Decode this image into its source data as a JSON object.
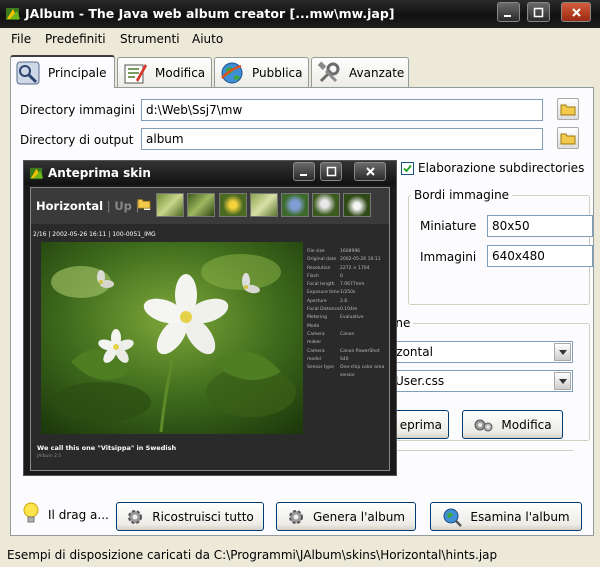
{
  "window": {
    "title": "JAlbum - The Java web album creator [...mw\\mw.jap]"
  },
  "menu": {
    "items": [
      {
        "label": "File"
      },
      {
        "label": "Predefiniti"
      },
      {
        "label": "Strumenti"
      },
      {
        "label": "Aiuto"
      }
    ]
  },
  "tabs": [
    {
      "label": "Principale",
      "icon": "settings-icon"
    },
    {
      "label": "Modifica",
      "icon": "edit-icon"
    },
    {
      "label": "Pubblica",
      "icon": "globe-icon"
    },
    {
      "label": "Avanzate",
      "icon": "tools-icon"
    }
  ],
  "main": {
    "image_dir_label": "Directory immagini",
    "image_dir_value": "d:\\Web\\Ssj7\\mw",
    "output_dir_label": "Directory di output",
    "output_dir_value": "album",
    "subdir_label": "Elaborazione subdirectories",
    "subdir_checked": true,
    "borders_title": "Bordi immagine",
    "thumbs_label": "Miniature",
    "thumbs_value": "80x50",
    "images_label": "Immagini",
    "images_value": "640x480",
    "layout_title_fragment": "one",
    "skin_value_fragment": "rizontal",
    "style_value_fragment": "kUser.css",
    "preview_button_fragment": "eprima",
    "edit_button": "Modifica",
    "drag_hint": "Il drag a...",
    "rebuild_button": "Ricostruisci tutto",
    "make_button": "Genera l'album",
    "browse_button": "Esamina l'album"
  },
  "status": {
    "text": "Esempi di disposizione caricati da C:\\Programmi\\JAlbum\\skins\\Horizontal\\hints.jap"
  },
  "preview": {
    "title": "Anteprima skin",
    "nav_main": "Horizontal",
    "nav_sep": " | ",
    "nav_up": "Up",
    "nav_sep2": " | ",
    "nav_page": "2",
    "info": "2/16 | 2002-05-26 16:11 | 100-0051_IMG",
    "meta": [
      [
        "File size",
        "1608996"
      ],
      [
        "Original date",
        "2002-05-26 16:11"
      ],
      [
        "Resolution",
        "2272 × 1704"
      ],
      [
        "Flash",
        "0"
      ],
      [
        "Focal length",
        "7.0677mm"
      ],
      [
        "Exposure time",
        "1/250s"
      ],
      [
        "Aperture",
        "2.8"
      ],
      [
        "Focal Distance",
        "0.104m"
      ],
      [
        "Metering Mode",
        "Evaluative"
      ],
      [
        "Camera maker",
        "Canon"
      ],
      [
        "Camera model",
        "Canon PowerShot S40"
      ],
      [
        "Sensor type",
        "One-chip color area sensor"
      ]
    ],
    "caption": "We call this one \"Vitsippa\" in Swedish",
    "credit": "JAlbum 2.5"
  },
  "colors": {
    "title_bar": "#1a1a1a",
    "panel_bg": "#fcfcfe",
    "window_bg": "#ece9d8",
    "field_border": "#7f9db9"
  }
}
